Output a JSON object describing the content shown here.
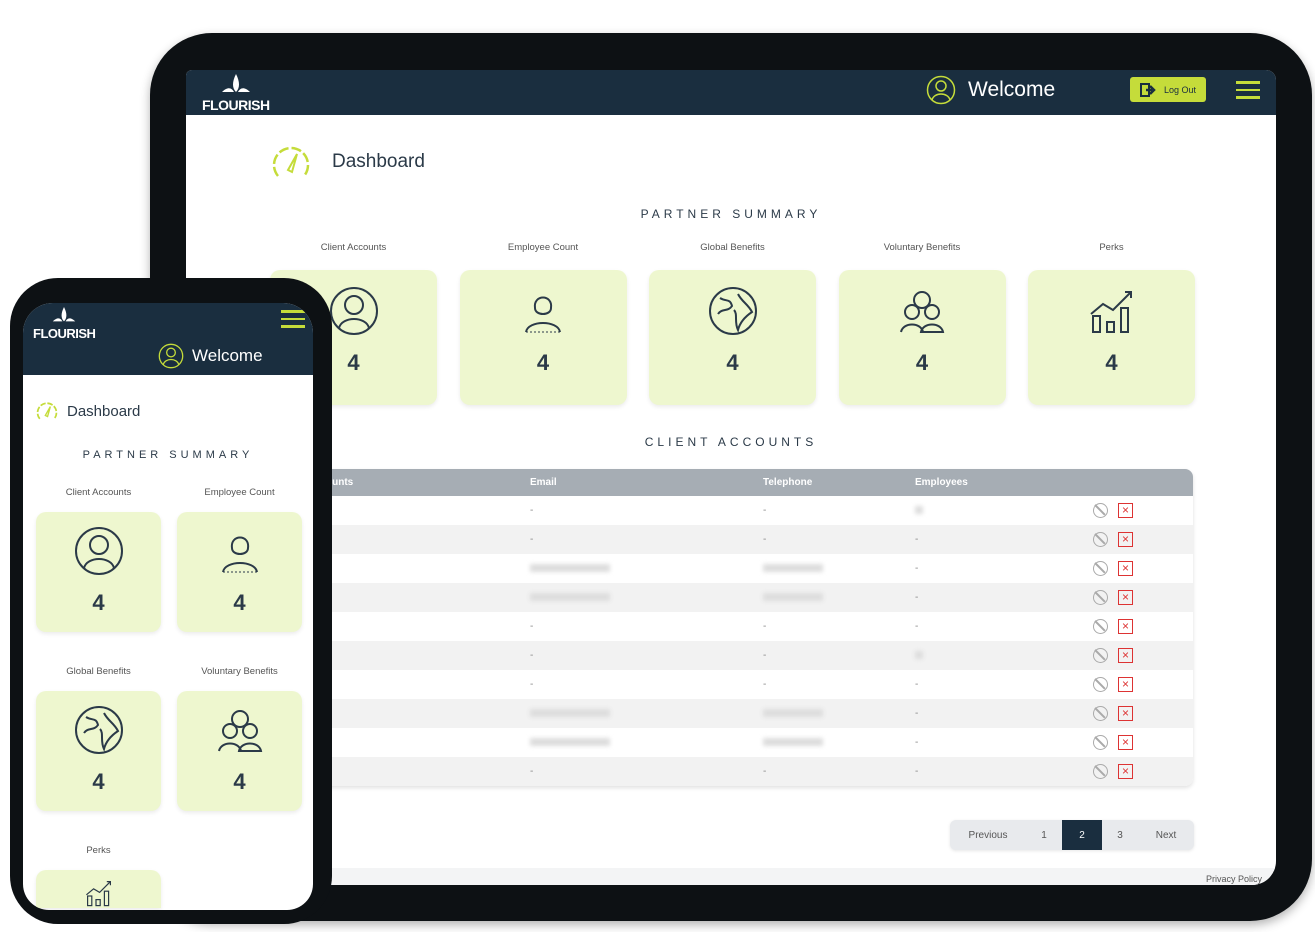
{
  "app": {
    "brand": "FLOURISH",
    "welcome": "Welcome",
    "logout": "Log Out",
    "page_title": "Dashboard",
    "privacy": "Privacy Policy"
  },
  "colors": {
    "accent": "#c5dc3a",
    "header": "#1a2e3f",
    "card": "#eef7cf",
    "danger": "#dd3333"
  },
  "summary": {
    "heading": "PARTNER SUMMARY",
    "cards": [
      {
        "label": "Client Accounts",
        "value": "4",
        "icon": "user-icon"
      },
      {
        "label": "Employee Count",
        "value": "4",
        "icon": "employee-icon"
      },
      {
        "label": "Global Benefits",
        "value": "4",
        "icon": "globe-icon"
      },
      {
        "label": "Voluntary Benefits",
        "value": "4",
        "icon": "group-icon"
      },
      {
        "label": "Perks",
        "value": "4",
        "icon": "chart-icon"
      }
    ]
  },
  "accounts": {
    "heading": "CLIENT ACCOUNTS",
    "columns": [
      "ounts",
      "Email",
      "Telephone",
      "Employees"
    ],
    "rows": [
      {
        "email": "-",
        "telephone": "-",
        "employees": "",
        "blur": [
          false,
          false,
          true
        ]
      },
      {
        "email": "-",
        "telephone": "-",
        "employees": "-",
        "blur": [
          false,
          false,
          false
        ]
      },
      {
        "email": "",
        "telephone": "",
        "employees": "-",
        "blur": [
          true,
          true,
          false
        ]
      },
      {
        "email": "",
        "telephone": "",
        "employees": "-",
        "blur": [
          true,
          true,
          false
        ]
      },
      {
        "email": "-",
        "telephone": "-",
        "employees": "-",
        "blur": [
          false,
          false,
          false
        ]
      },
      {
        "email": "-",
        "telephone": "-",
        "employees": "",
        "blur": [
          false,
          false,
          true
        ]
      },
      {
        "email": "-",
        "telephone": "-",
        "employees": "-",
        "blur": [
          false,
          false,
          false
        ]
      },
      {
        "email": "",
        "telephone": "",
        "employees": "-",
        "blur": [
          true,
          true,
          false
        ]
      },
      {
        "email": "",
        "telephone": "",
        "employees": "-",
        "blur": [
          true,
          true,
          false
        ]
      },
      {
        "email": "-",
        "telephone": "-",
        "employees": "-",
        "blur": [
          false,
          false,
          false
        ]
      }
    ]
  },
  "pagination": {
    "previous": "Previous",
    "pages": [
      "1",
      "2",
      "3"
    ],
    "current": "2",
    "next": "Next"
  },
  "icons": {
    "disable": "ban-icon",
    "delete": "close-icon",
    "menu": "hamburger-icon",
    "logout": "logout-icon",
    "dashboard": "speedometer-icon"
  }
}
